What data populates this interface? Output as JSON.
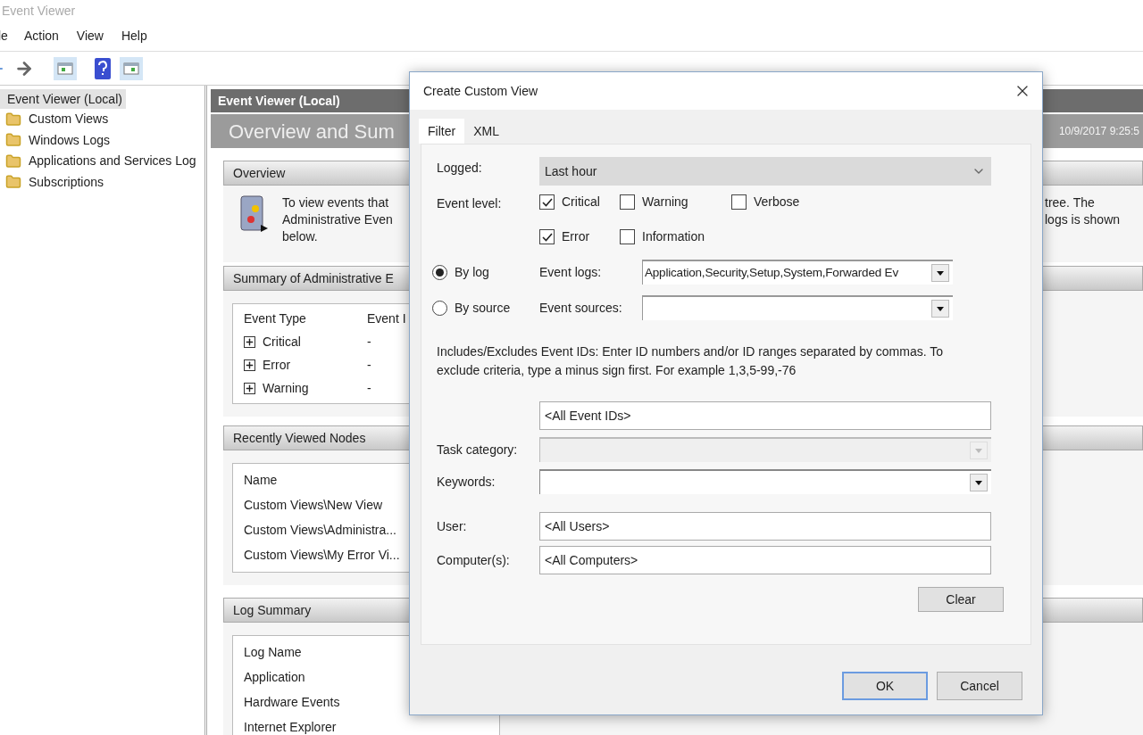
{
  "window": {
    "title": "Event Viewer"
  },
  "menu": [
    "le",
    "Action",
    "View",
    "Help"
  ],
  "tree": [
    {
      "label": "Event Viewer (Local)",
      "selected": true,
      "children": [
        {
          "label": "Custom Views",
          "selected": false
        },
        {
          "label": "Windows Logs",
          "selected": false
        },
        {
          "label": "Applications and Services Log",
          "selected": false
        },
        {
          "label": "Subscriptions",
          "selected": false
        }
      ]
    }
  ],
  "main": {
    "header": "Event Viewer (Local)",
    "banner_title": "Overview and Sum",
    "banner_date": "10/9/2017 9:25:5",
    "overview": {
      "title": "Overview",
      "text_left": [
        "To view events that",
        "Administrative Even",
        "below."
      ],
      "text_right": [
        "tree. The",
        "logs is shown"
      ]
    },
    "summary": {
      "title": "Summary of Administrative E",
      "columns": [
        "Event Type",
        "Event I"
      ],
      "rows": [
        {
          "type": "Critical",
          "value": "-"
        },
        {
          "type": "Error",
          "value": "-"
        },
        {
          "type": "Warning",
          "value": "-"
        }
      ]
    },
    "recent": {
      "title": "Recently Viewed Nodes",
      "column": "Name",
      "rows": [
        "Custom Views\\New View",
        "Custom Views\\Administra...",
        "Custom Views\\My Error Vi..."
      ]
    },
    "log_summary": {
      "title": "Log Summary",
      "column": "Log Name",
      "rows": [
        "Application",
        "Hardware Events",
        "Internet Explorer"
      ]
    }
  },
  "dialog": {
    "title": "Create Custom View",
    "tabs": [
      {
        "label": "Filter",
        "selected": true
      },
      {
        "label": "XML",
        "selected": false
      }
    ],
    "logged": {
      "label": "Logged:",
      "value": "Last hour"
    },
    "event_level": {
      "label": "Event level:",
      "options": [
        {
          "label": "Critical",
          "checked": true
        },
        {
          "label": "Warning",
          "checked": false
        },
        {
          "label": "Verbose",
          "checked": false
        },
        {
          "label": "Error",
          "checked": true
        },
        {
          "label": "Information",
          "checked": false
        }
      ]
    },
    "source_modes": [
      {
        "label": "By log",
        "selected": true,
        "field_label": "Event logs:",
        "value": "Application,Security,Setup,System,Forwarded Ev"
      },
      {
        "label": "By source",
        "selected": false,
        "field_label": "Event sources:"
      }
    ],
    "ids": {
      "hint": "Includes/Excludes Event IDs: Enter ID numbers and/or ID ranges separated by commas. To exclude criteria, type a minus sign first. For example 1,3,5-99,-76",
      "value": "<All Event IDs>"
    },
    "combos": [
      {
        "label": "Task category:",
        "disabled": true
      },
      {
        "label": "Keywords:",
        "disabled": false
      }
    ],
    "text_fields": [
      {
        "label": "User:",
        "value": "<All Users>"
      },
      {
        "label": "Computer(s):",
        "value": "<All Computers>"
      }
    ],
    "clear": "Clear",
    "buttons": [
      {
        "label": "OK",
        "focused": true
      },
      {
        "label": "Cancel",
        "focused": false
      }
    ]
  }
}
